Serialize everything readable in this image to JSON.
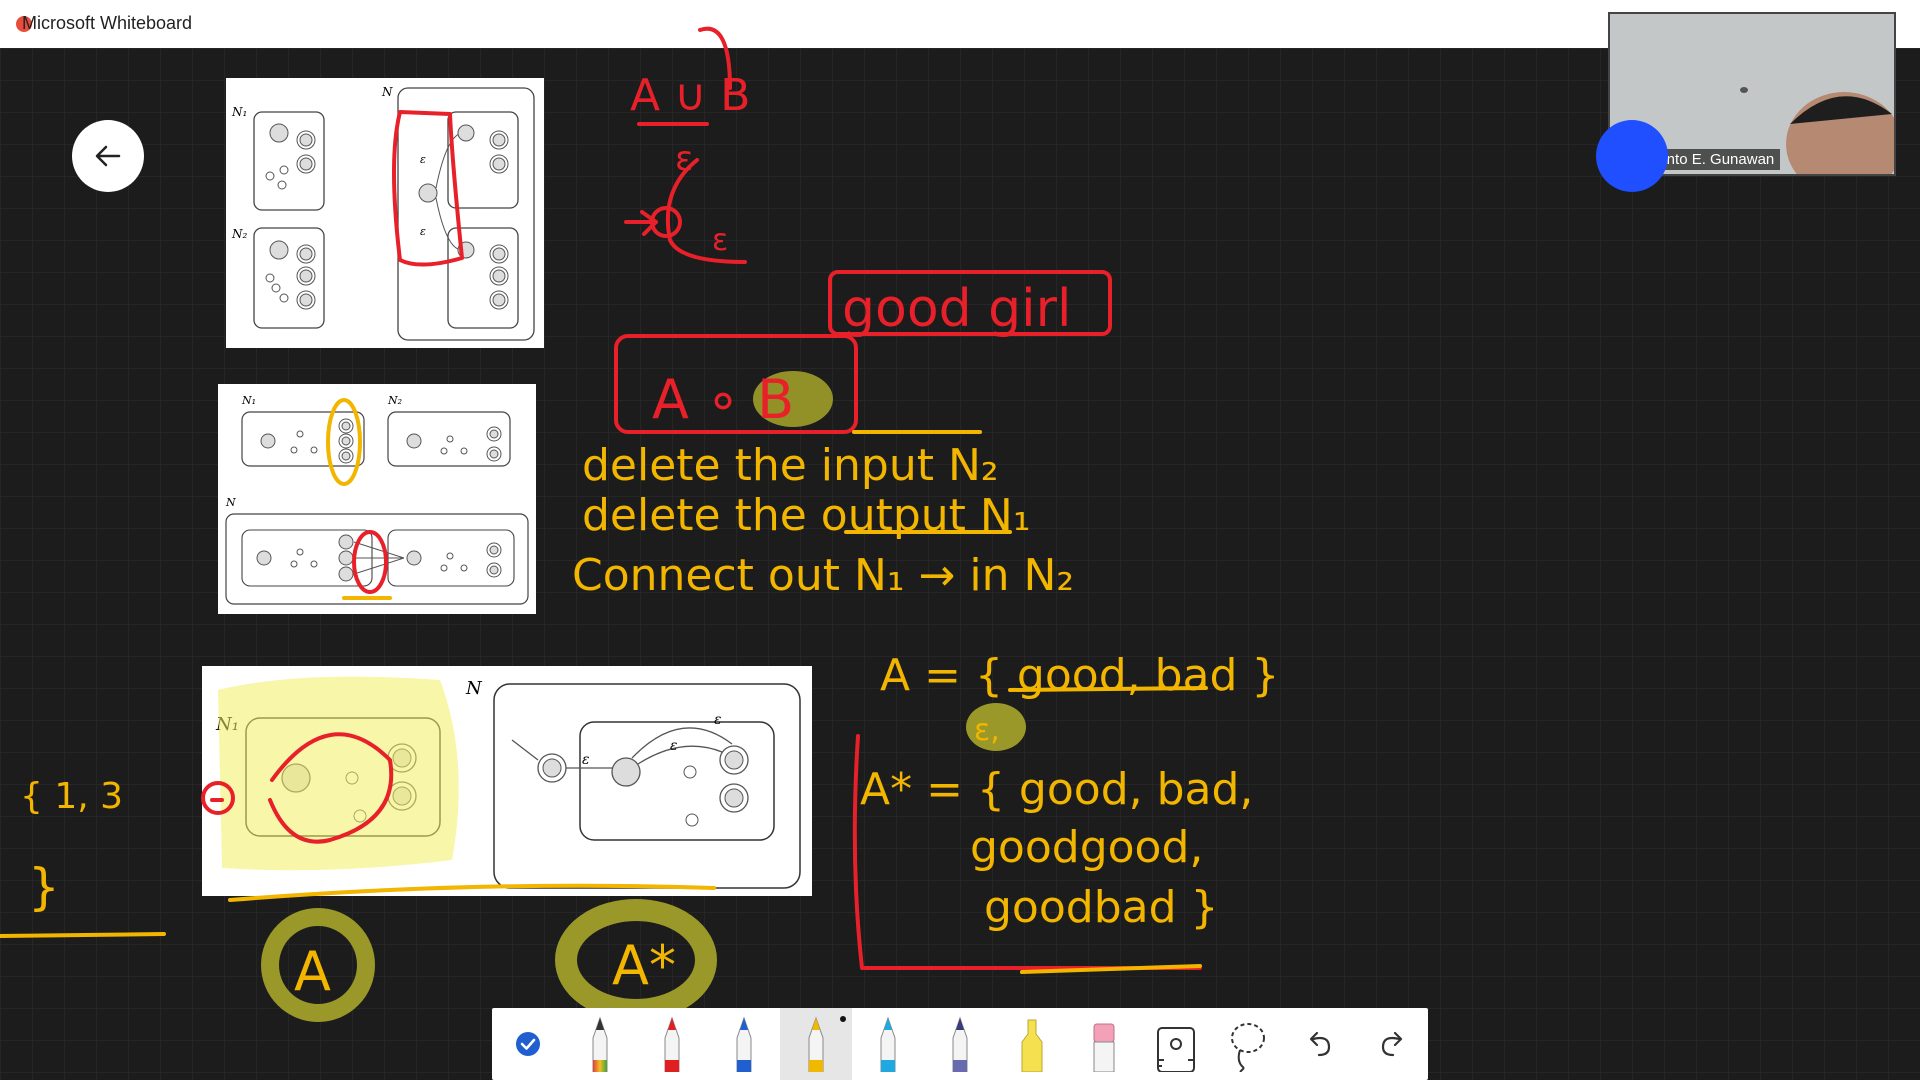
{
  "window": {
    "title": "Microsoft Whiteboard"
  },
  "participant": {
    "name": "Fergyanto  E. Gunawan"
  },
  "diagram_labels": {
    "top": {
      "n1": "N₁",
      "n2": "N₂",
      "n": "N",
      "eps": "ε"
    },
    "middle": {
      "n1": "N₁",
      "n2": "N₂",
      "n": "N"
    },
    "bottom": {
      "n1": "N₁",
      "n": "N",
      "eps": "ε"
    }
  },
  "handwriting": {
    "union": "A ∪ B",
    "eps1": "ε",
    "eps2": "ε",
    "goodgirl": "good girl",
    "concat": "A ∘ B",
    "line1": "delete the input N₂",
    "line2": "delete the output N₁",
    "line3": "Connect out N₁ → in N₂",
    "setA": "A = { good, bad }",
    "star_eps": "ε,",
    "star_line1": "A* = { good, bad,",
    "star_line2": "goodgood,",
    "star_line3": "goodbad }",
    "left_set": "{ 1, 3",
    "left_close": "}",
    "label_A": "A",
    "label_Astar": "A*"
  },
  "toolbar": {
    "tools": [
      {
        "name": "select-tool",
        "icon": "check-circle-icon"
      },
      {
        "name": "pen-rainbow",
        "icon": "pen-icon",
        "color": "#e04040"
      },
      {
        "name": "pen-red",
        "icon": "pen-icon",
        "color": "#e02020"
      },
      {
        "name": "pen-blue",
        "icon": "pen-icon",
        "color": "#1f5fd0"
      },
      {
        "name": "pen-yellow",
        "icon": "pen-icon",
        "color": "#f2b800",
        "selected": true
      },
      {
        "name": "pen-lightblue",
        "icon": "pen-icon",
        "color": "#20a8e0"
      },
      {
        "name": "pen-galaxy",
        "icon": "pen-icon",
        "color": "#6a6ab0"
      },
      {
        "name": "highlighter",
        "icon": "highlighter-icon",
        "color": "#f5e050"
      },
      {
        "name": "eraser",
        "icon": "eraser-icon",
        "color": "#f4a0b8"
      },
      {
        "name": "ruler",
        "icon": "ruler-icon"
      },
      {
        "name": "lasso",
        "icon": "lasso-icon"
      },
      {
        "name": "undo",
        "icon": "undo-icon"
      },
      {
        "name": "redo",
        "icon": "redo-icon"
      }
    ]
  },
  "colors": {
    "red_ink": "#e8202a",
    "yellow_ink": "#f2b500",
    "highlight_yellow": "#f3ef60",
    "olive_highlight": "#a7a62a",
    "board_bg": "#1c1c1c"
  }
}
